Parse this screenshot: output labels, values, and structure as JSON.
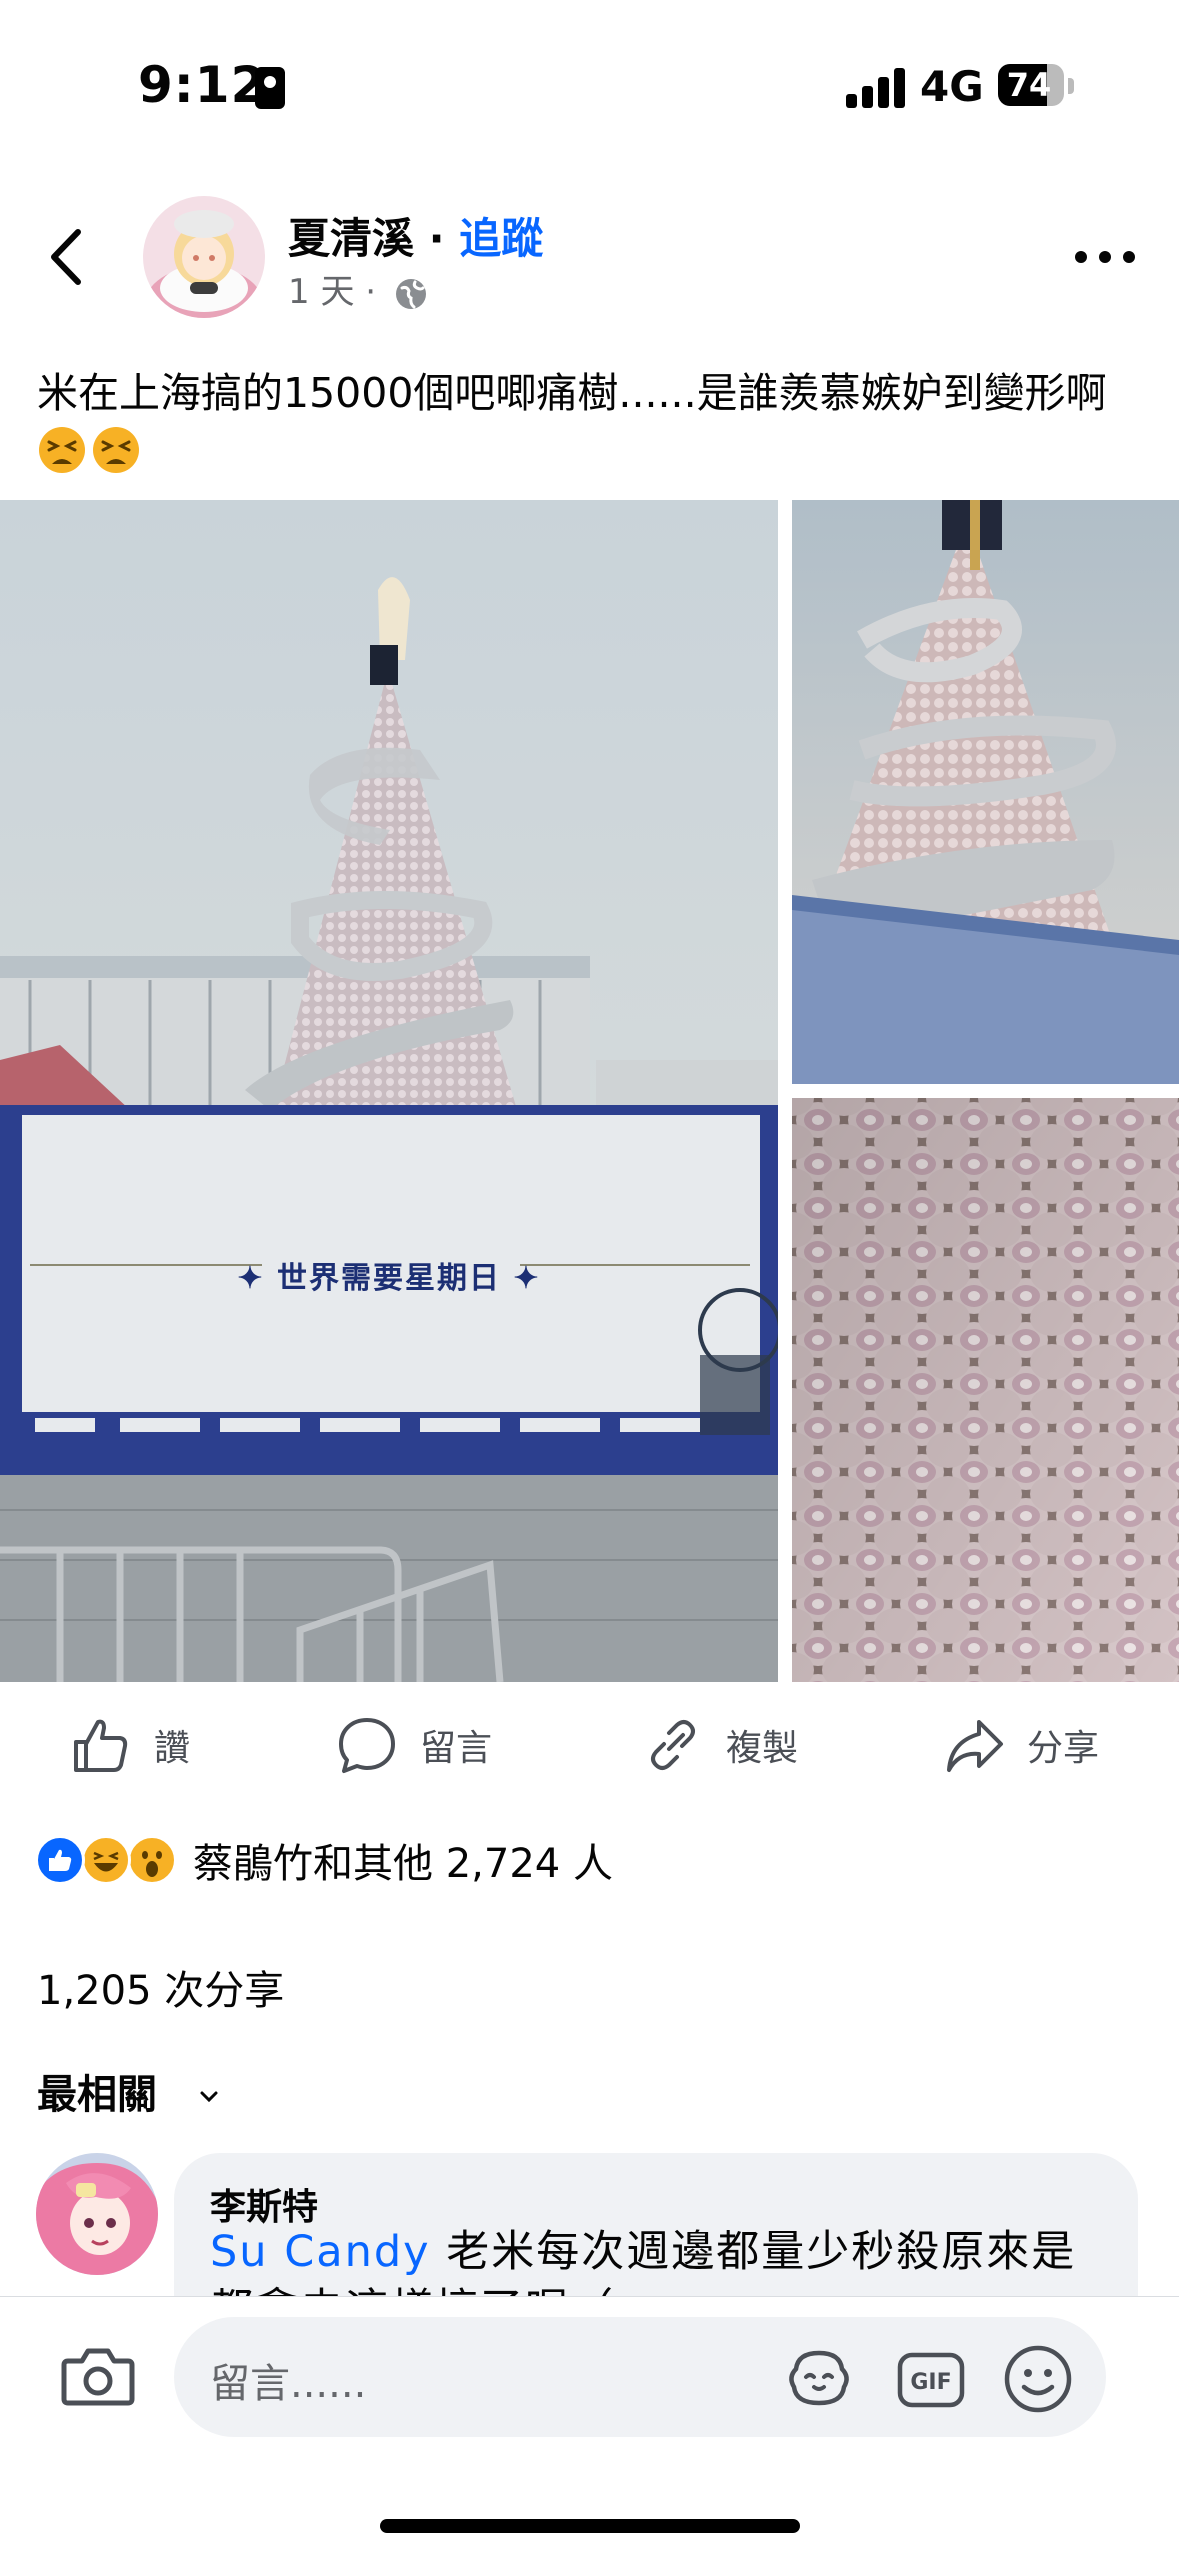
{
  "status_bar": {
    "time": "9:12",
    "network": "4G",
    "battery_percent": "74",
    "battery_level": 0.74,
    "signal_bars": 4
  },
  "post": {
    "author": "夏清溪",
    "separator": " · ",
    "follow_label": "追蹤",
    "time_ago": "1 天 ·",
    "text": "米在上海搞的15000個吧唧痛樹......是誰羨慕嫉妒到變形啊",
    "emoji_name": "tired-face-emoji",
    "photo_board_text": "✦ 世界需要星期日 ✦"
  },
  "actions": {
    "like": "讚",
    "comment": "留言",
    "copy": "複製",
    "share": "分享"
  },
  "reactions": {
    "icons": [
      "like",
      "haha",
      "wow"
    ],
    "colors": {
      "like": "#0866ff",
      "haha": "#f7b125",
      "wow": "#f7b125"
    },
    "summary": "蔡鵑竹和其他 2,724 人"
  },
  "shares": "1,205 次分享",
  "sort": {
    "label": "最相關"
  },
  "comment": {
    "name": "李斯特",
    "mention": "Su Candy",
    "text": " 老米每次週邊都量少秒殺原來是都拿去這樣搞了喔（"
  },
  "composer": {
    "placeholder": "留言......",
    "gif_label": "GIF"
  },
  "colors": {
    "accent": "#0866ff",
    "secondary_text": "#65676b",
    "bubble": "#f0f2f5"
  }
}
